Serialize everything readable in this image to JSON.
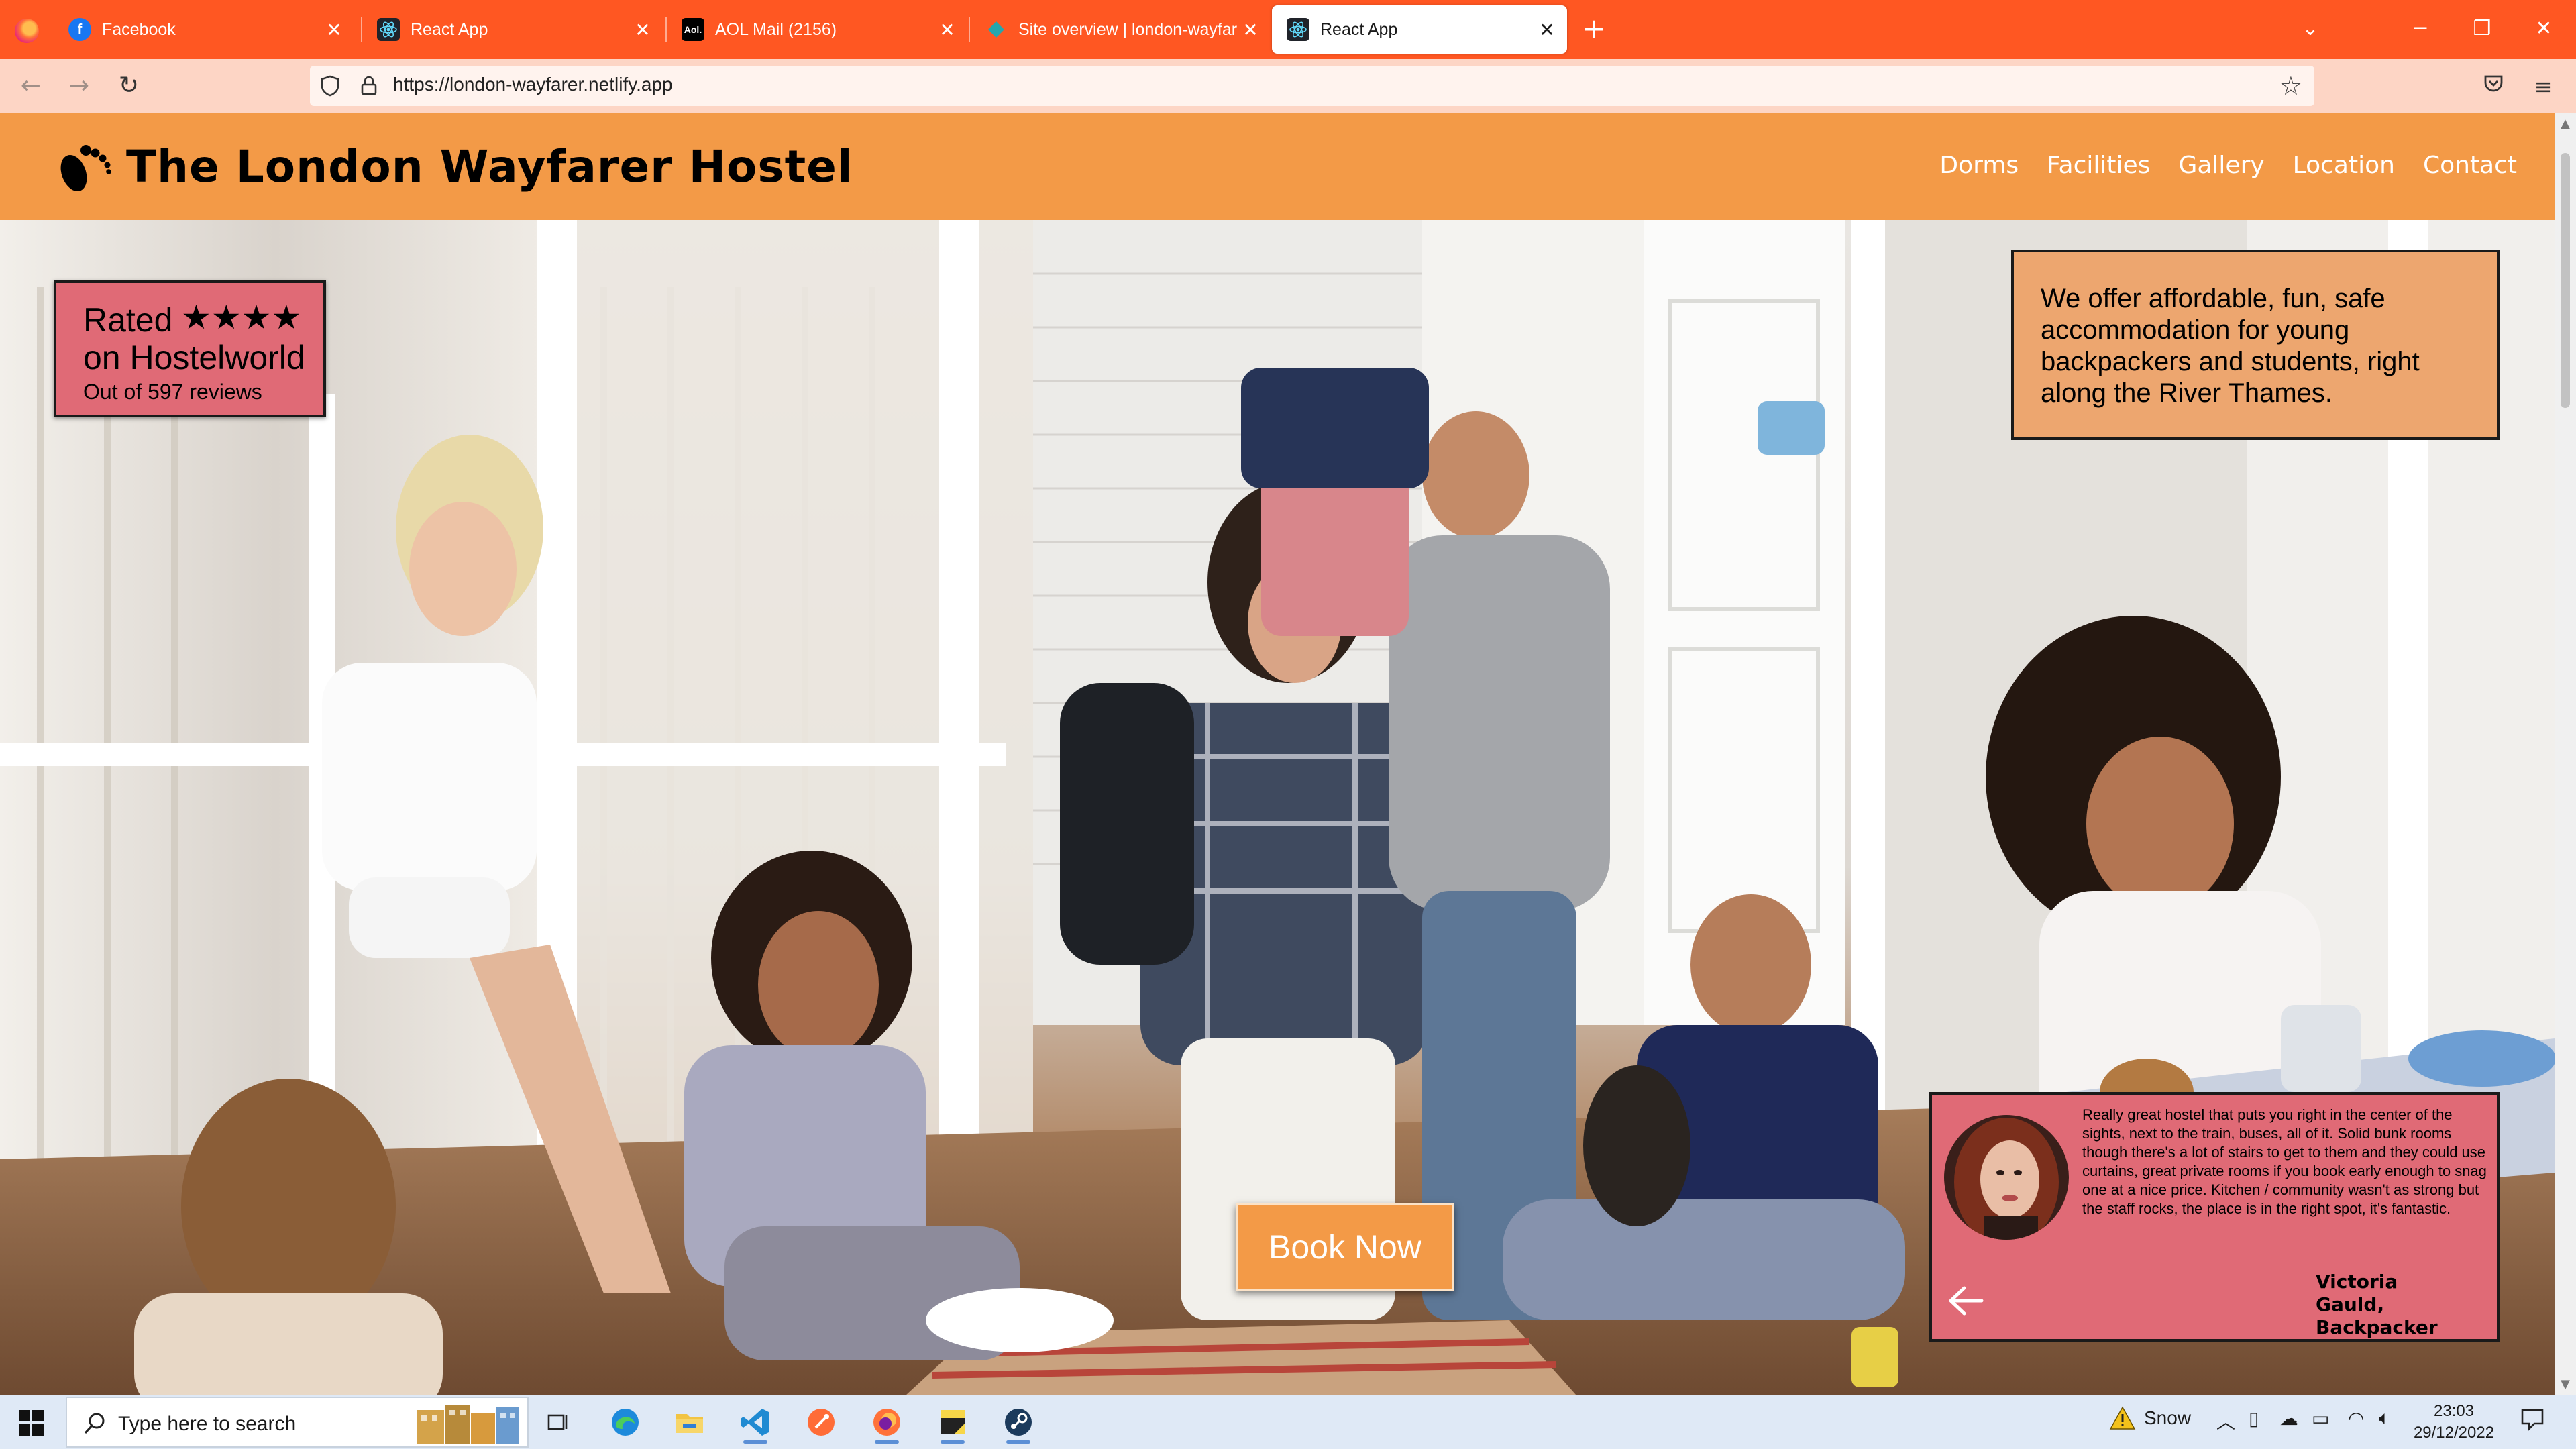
{
  "browser": {
    "tabs": [
      {
        "title": "Facebook",
        "icon": "facebook-icon"
      },
      {
        "title": "React App",
        "icon": "react-icon"
      },
      {
        "title": "AOL Mail (2156)",
        "icon": "aol-icon"
      },
      {
        "title": "Site overview | london-wayfarer",
        "icon": "netlify-icon"
      },
      {
        "title": "React App",
        "icon": "react-icon",
        "active": true
      }
    ],
    "url": "https://london-wayfarer.netlify.app"
  },
  "site": {
    "title": "The London Wayfarer Hostel",
    "nav": [
      "Dorms",
      "Facilities",
      "Gallery",
      "Location",
      "Contact"
    ],
    "rating": {
      "label": "Rated",
      "stars": "★★★★",
      "star_count": 4,
      "site": "on Hostelworld",
      "reviews": "Out of 597 reviews"
    },
    "intro": "We offer affordable, fun, safe accommodation for young backpackers and students, right along the River Thames.",
    "book_label": "Book Now",
    "review": {
      "text": "Really great hostel that puts you right in the center of the sights, next to the train, buses, all of it. Solid bunk rooms though there's a lot of stairs to get to them and they could use curtains, great private rooms if you book early enough to snag one at a nice price. Kitchen / community wasn't as strong but the staff rocks, the place is in the right spot, it's fantastic.",
      "author": "Victoria Gauld, Backpacker"
    }
  },
  "taskbar": {
    "search_placeholder": "Type here to search",
    "weather": "Snow",
    "time": "23:03",
    "date": "29/12/2022"
  },
  "colors": {
    "browser_accent": "#ff5722",
    "header": "#f39a47",
    "rating_box": "#e06a76",
    "intro_box": "#eda66f",
    "book_button": "#f39a47"
  }
}
